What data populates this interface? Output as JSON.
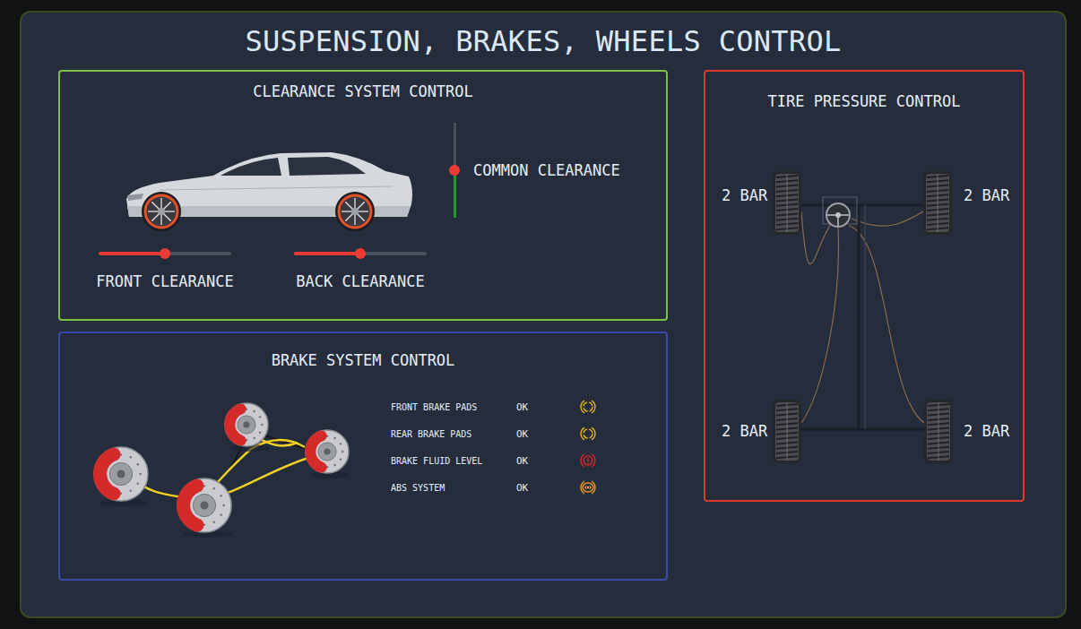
{
  "title": "SUSPENSION, BRAKES, WHEELS CONTROL",
  "clearance": {
    "title": "CLEARANCE SYSTEM CONTROL",
    "sliders": [
      {
        "label": "FRONT CLEARANCE",
        "level": 0.5
      },
      {
        "label": "BACK CLEARANCE",
        "level": 0.5
      }
    ],
    "common": {
      "label": "COMMON CLEARANCE",
      "level": 0.5
    }
  },
  "brakes": {
    "title": "BRAKE SYSTEM CONTROL",
    "items": [
      {
        "label": "FRONT BRAKE PADS",
        "status": "OK",
        "kind": "pads",
        "color": "#e8b41c"
      },
      {
        "label": "REAR BRAKE PADS",
        "status": "OK",
        "kind": "pads",
        "color": "#e8b41c"
      },
      {
        "label": "BRAKE FLUID LEVEL",
        "status": "OK",
        "kind": "fluid",
        "color": "#d8262a"
      },
      {
        "label": "ABS SYSTEM",
        "status": "OK",
        "kind": "abs",
        "color": "#e89a1c"
      }
    ]
  },
  "tires": {
    "title": "TIRE PRESSURE CONTROL",
    "front": [
      "2 BAR",
      "2 BAR"
    ],
    "rear": [
      "2 BAR",
      "2 BAR"
    ]
  }
}
